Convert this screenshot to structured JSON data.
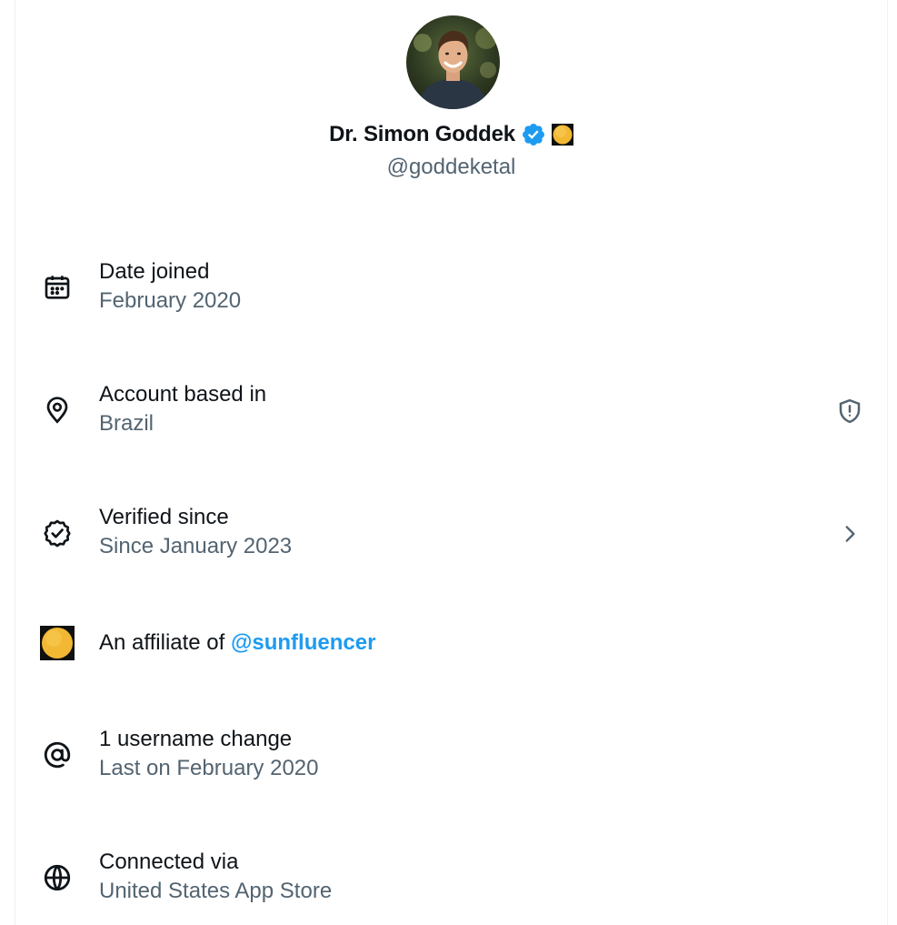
{
  "profile": {
    "name": "Dr. Simon Goddek",
    "handle": "@goddeketal",
    "avatar_icon": "avatar-photo",
    "verified_icon": "verified-badge-icon",
    "affiliate_icon": "sun-affiliate-icon"
  },
  "rows": {
    "date_joined": {
      "title": "Date joined",
      "value": "February 2020",
      "icon": "calendar-icon"
    },
    "based_in": {
      "title": "Account based in",
      "value": "Brazil",
      "icon": "location-pin-icon",
      "trailing_icon": "shield-alert-icon"
    },
    "verified": {
      "title": "Verified since",
      "value": "Since January 2023",
      "icon": "verified-check-icon",
      "trailing_icon": "chevron-right-icon"
    },
    "affiliate": {
      "prefix": "An affiliate of ",
      "link": "@sunfluencer",
      "icon": "sun-affiliate-icon"
    },
    "username": {
      "title": "1 username change",
      "value": "Last on February 2020",
      "icon": "at-sign-icon"
    },
    "connected": {
      "title": "Connected via",
      "value": "United States App Store",
      "icon": "globe-icon"
    }
  },
  "colors": {
    "accent": "#1d9bf0",
    "secondary_text": "#536471",
    "primary_text": "#0f1419",
    "affiliate_gold": "#f2b833"
  }
}
